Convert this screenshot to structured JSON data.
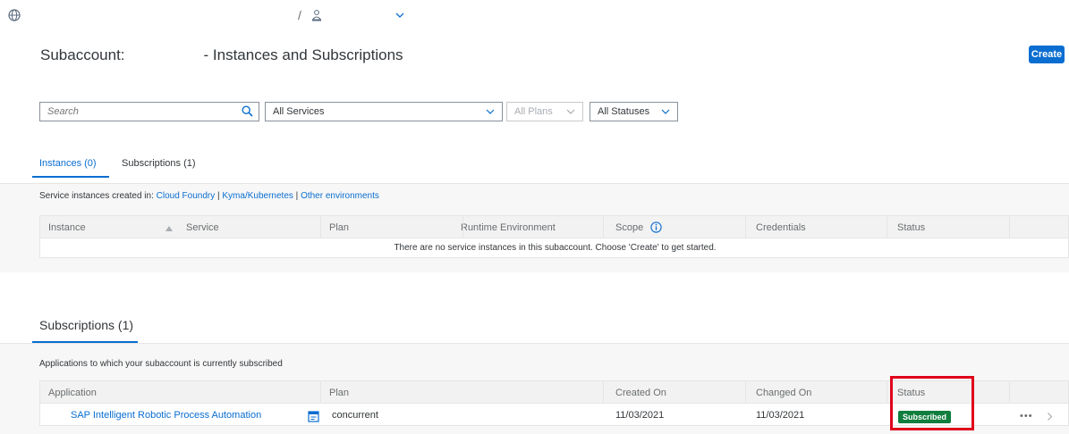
{
  "header": {
    "title_prefix": "Subaccount:",
    "title_suffix": "- Instances and Subscriptions",
    "create_label": "Create",
    "breadcrumb_separator": "/"
  },
  "filters": {
    "search_placeholder": "Search",
    "services": "All Services",
    "plans": "All Plans",
    "statuses": "All Statuses"
  },
  "tabs": [
    {
      "label": "Instances (0)",
      "active": true
    },
    {
      "label": "Subscriptions (1)",
      "active": false
    }
  ],
  "instances": {
    "caption_prefix": "Service instances created in:",
    "env_links": [
      "Cloud Foundry",
      "Kyma/Kubernetes",
      "Other environments"
    ],
    "separator": "|",
    "columns": [
      "Instance",
      "Service",
      "Plan",
      "Runtime Environment",
      "Scope",
      "Credentials",
      "Status"
    ],
    "empty_message": "There are no service instances in this subaccount. Choose 'Create' to get started."
  },
  "subscriptions": {
    "title": "Subscriptions (1)",
    "caption": "Applications to which your subaccount is currently subscribed",
    "columns": [
      "Application",
      "Plan",
      "Created On",
      "Changed On",
      "Status"
    ],
    "rows": [
      {
        "application": "SAP Intelligent Robotic Process Automation",
        "plan": "concurrent",
        "created_on": "11/03/2021",
        "changed_on": "11/03/2021",
        "status": "Subscribed",
        "more": "•••"
      }
    ]
  },
  "colors": {
    "accent": "#0a6ed1",
    "success": "#107e3e",
    "highlight": "#e0001b"
  },
  "icons": [
    "globe-icon",
    "user-group-icon",
    "chevron-down-icon",
    "search-icon",
    "info-icon",
    "sort-ascending-icon",
    "app-launch-icon",
    "chevron-right-icon"
  ]
}
